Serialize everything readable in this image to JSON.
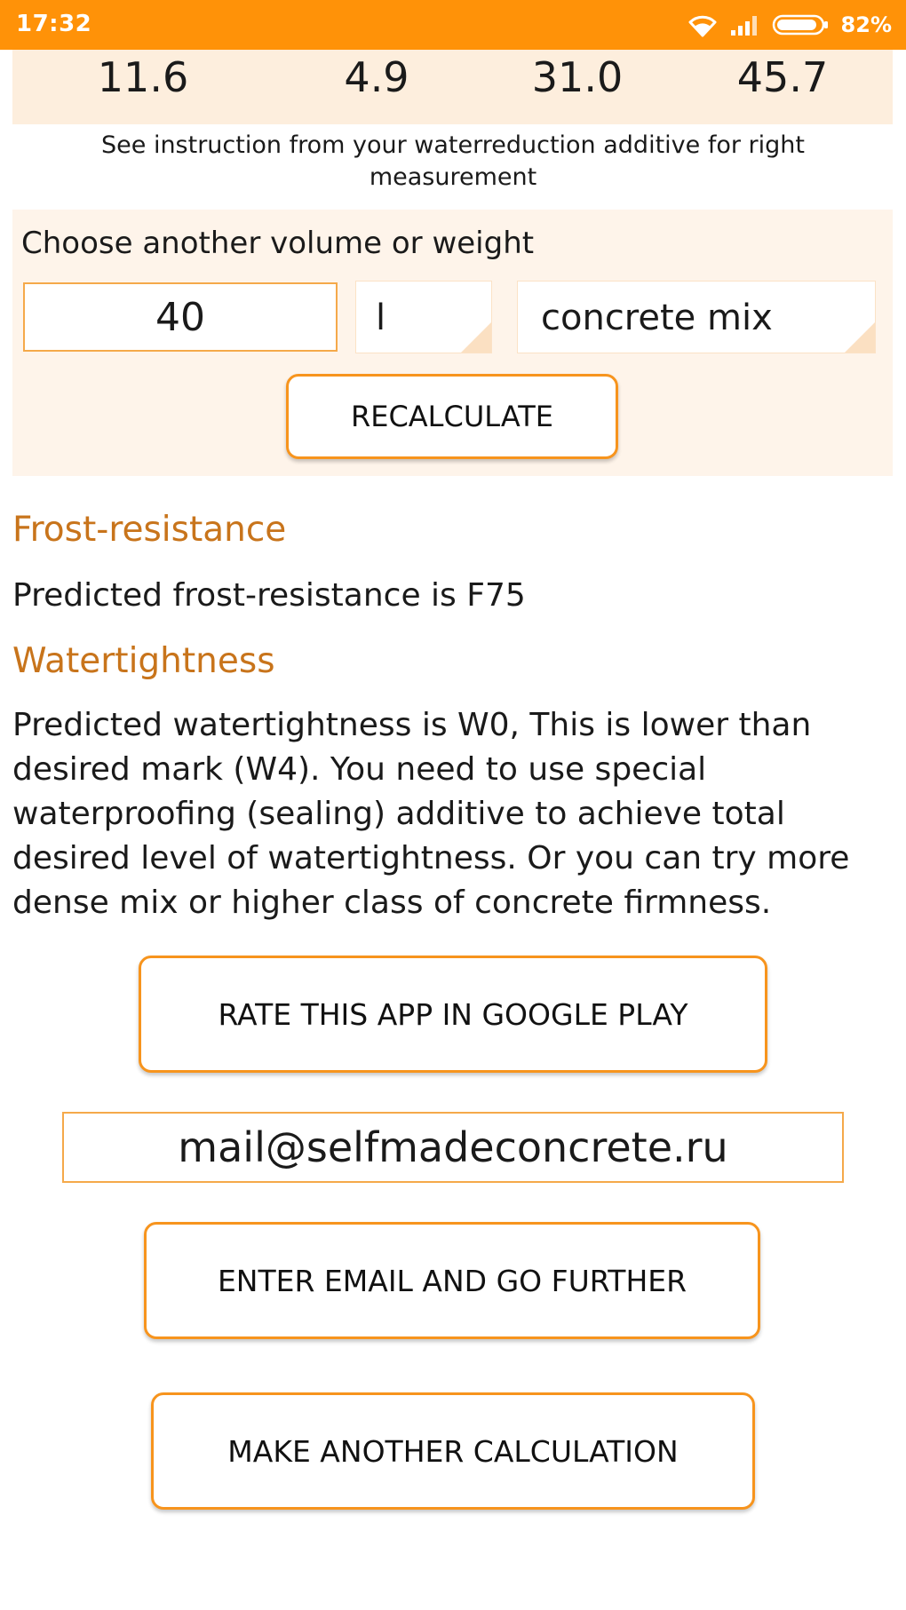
{
  "status_bar": {
    "time": "17:32",
    "battery_percent": "82%",
    "icons": [
      "wifi-icon",
      "signal-icon",
      "battery-icon"
    ],
    "color": "#ff9208"
  },
  "values_row": [
    "11.6",
    "4.9",
    "31.0",
    "45.7"
  ],
  "note": "See instruction from your waterreduction additive for right measurement",
  "recalc": {
    "title": "Choose another volume or weight",
    "amount_value": "40",
    "unit_selected": "l",
    "material_selected": "concrete mix",
    "button_label": "RECALCULATE"
  },
  "frost": {
    "heading": "Frost-resistance",
    "text": "Predicted frost-resistance is F75"
  },
  "water": {
    "heading": "Watertightness",
    "text": "Predicted watertightness is W0, This is lower than desired mark (W4). You need to use special waterproofing (sealing) additive to achieve total desired level of watertightness. Or you can try more dense mix or higher class of concrete firmness."
  },
  "actions": {
    "rate_label": "RATE THIS APP IN GOOGLE PLAY",
    "email_value": "mail@selfmadeconcrete.ru",
    "email_button_label": "ENTER EMAIL AND GO FURTHER",
    "another_label": "MAKE ANOTHER CALCULATION"
  },
  "colors": {
    "accent": "#f7941d",
    "heading": "#c8741b",
    "panel": "#fdeedd"
  }
}
